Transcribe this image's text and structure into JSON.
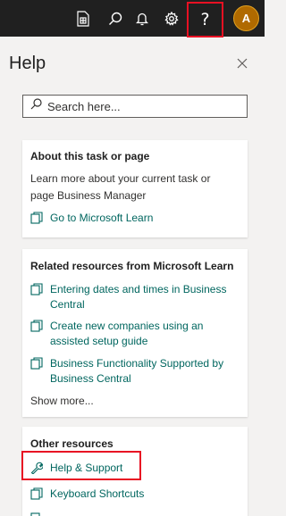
{
  "topbar": {
    "icons": [
      "document-icon",
      "search-icon",
      "bell-icon",
      "gear-icon"
    ],
    "help_label": "?",
    "avatar_initial": "A"
  },
  "panel": {
    "title": "Help",
    "search_placeholder": "Search here..."
  },
  "about_card": {
    "title": "About this task or page",
    "description": "Learn more about your current task or page Business Manager",
    "link": "Go to Microsoft Learn"
  },
  "resources_card": {
    "title": "Related resources from Microsoft Learn",
    "links": [
      "Entering dates and times in Business Central",
      "Create new companies using an assisted setup guide",
      "Business Functionality Supported by Business Central"
    ],
    "show_more": "Show more..."
  },
  "other_card": {
    "title": "Other resources",
    "links": [
      "Help & Support",
      "Keyboard Shortcuts"
    ]
  },
  "colors": {
    "topbar": "#202020",
    "link": "#00665f",
    "highlight": "#e81123",
    "avatar": "#b06a00"
  }
}
